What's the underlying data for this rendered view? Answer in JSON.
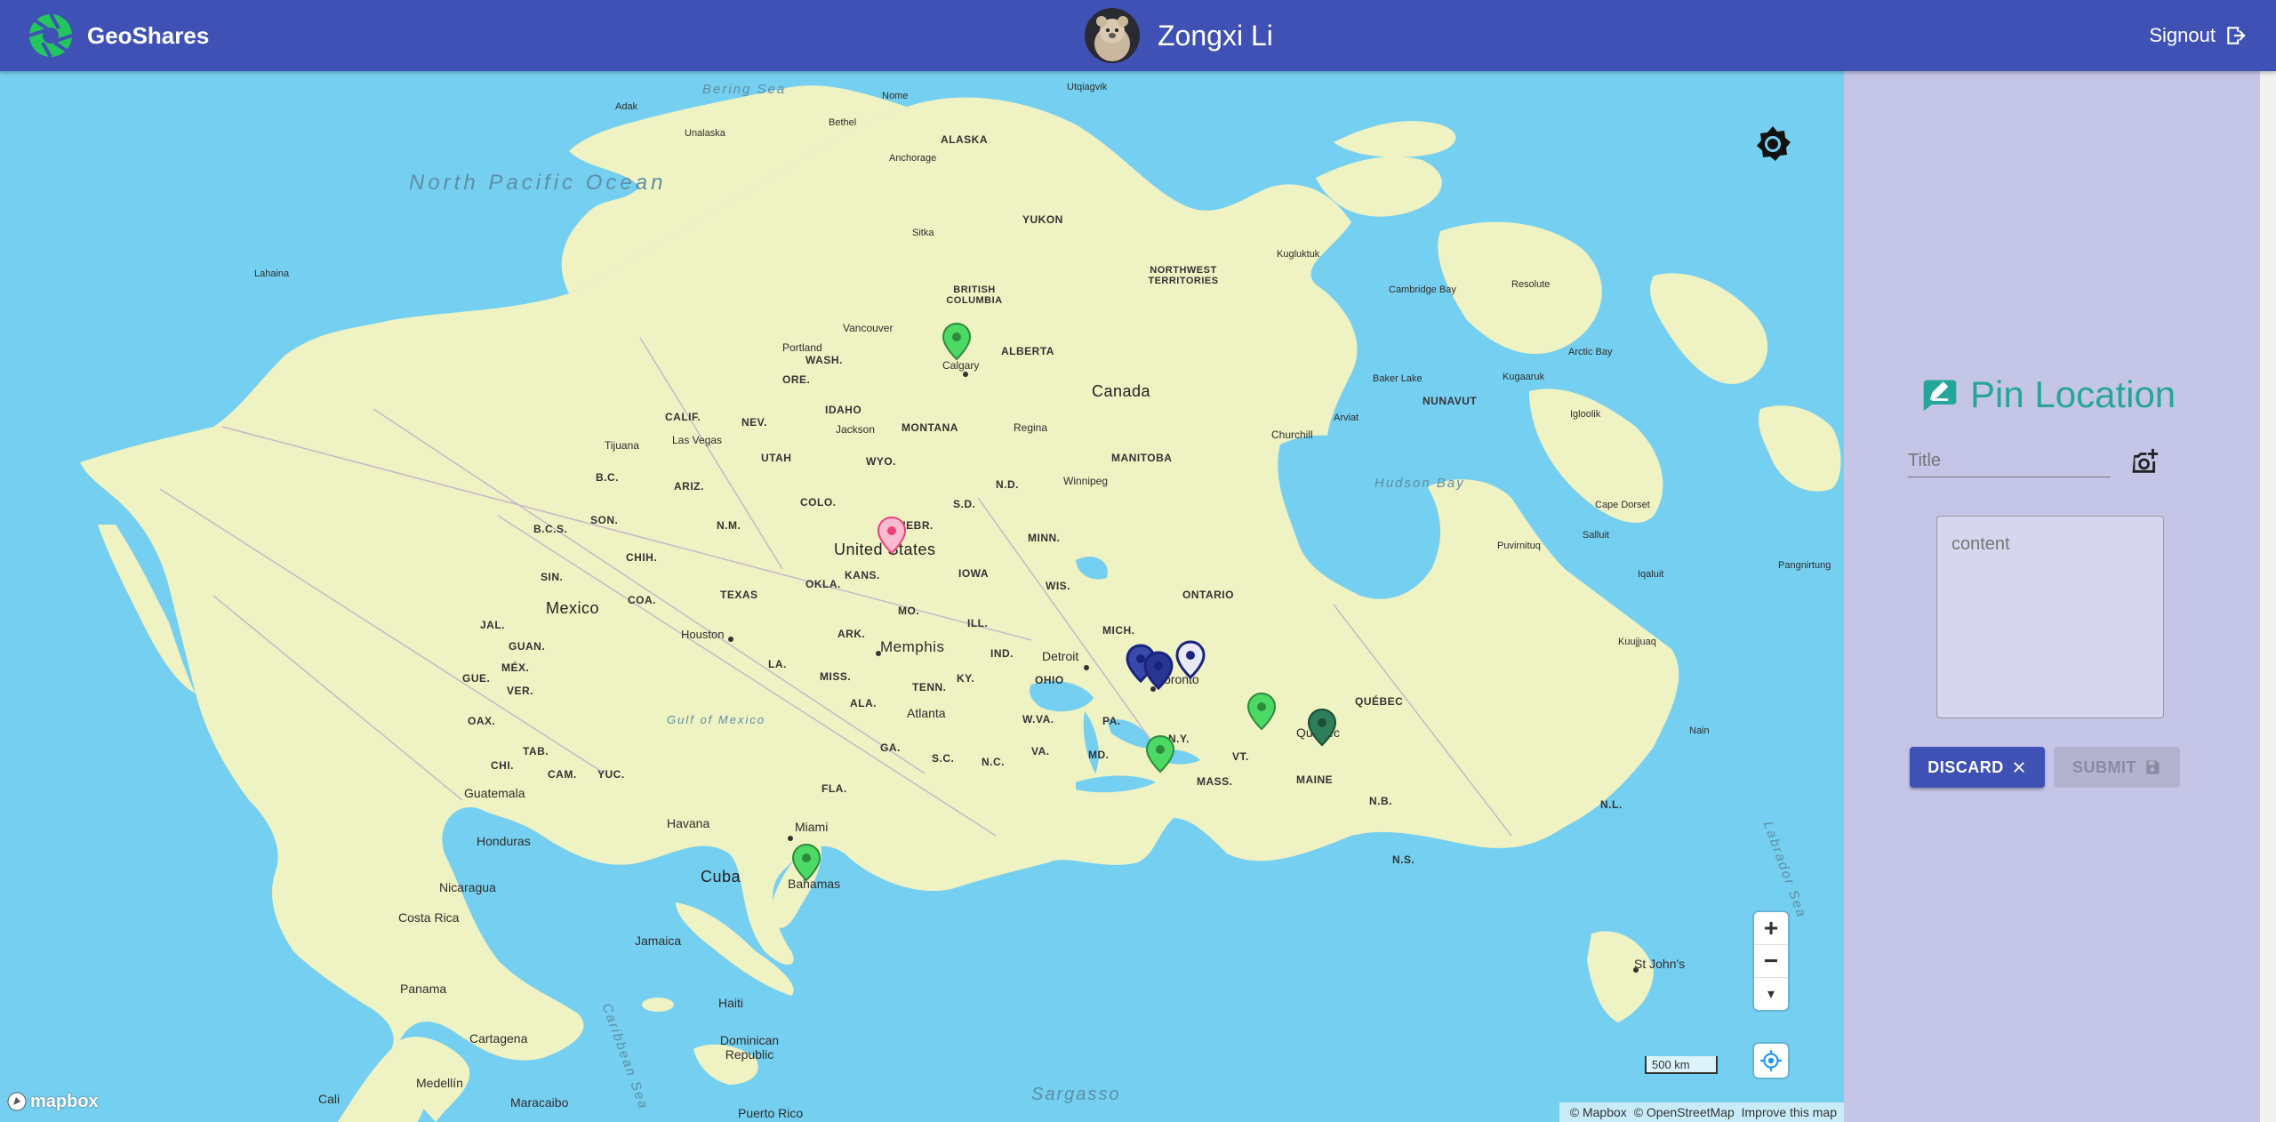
{
  "header": {
    "app_name": "GeoShares",
    "user_name": "Zongxi Li",
    "signout_label": "Signout"
  },
  "map": {
    "water_labels": [
      "North Pacific Ocean",
      "Bering Sea",
      "Hudson Bay",
      "Gulf of Mexico",
      "Caribbean Sea",
      "Labrador Sea",
      "Sargasso"
    ],
    "countries": [
      "Canada",
      "United States",
      "Mexico",
      "Cuba"
    ],
    "region_labels": [
      "ALASKA",
      "YUKON",
      "BRITISH COLUMBIA",
      "NORTHWEST TERRITORIES",
      "ALBERTA",
      "NUNAVUT",
      "MANITOBA",
      "ONTARIO",
      "QUÉBEC",
      "WASH.",
      "ORE.",
      "IDAHO",
      "MONTANA",
      "CALIF.",
      "NEV.",
      "UTAH",
      "WYO.",
      "ARIZ.",
      "COLO.",
      "N.M.",
      "NEBR.",
      "S.D.",
      "N.D.",
      "MINN.",
      "IOWA",
      "WIS.",
      "MICH.",
      "ILL.",
      "IND.",
      "OHIO",
      "KY.",
      "TENN.",
      "MO.",
      "KANS.",
      "OKLA.",
      "TEXAS",
      "ARK.",
      "LA.",
      "MISS.",
      "ALA.",
      "GA.",
      "FLA.",
      "S.C.",
      "N.C.",
      "VA.",
      "W.VA.",
      "PA.",
      "N.Y.",
      "VT.",
      "MAINE",
      "MASS.",
      "MD.",
      "N.B.",
      "N.S.",
      "N.L.",
      "SON.",
      "CHIH.",
      "COA.",
      "B.C.S.",
      "SIN.",
      "JAL.",
      "GUAN.",
      "MÉX.",
      "VER.",
      "OAX.",
      "TAB.",
      "CAM.",
      "YUC.",
      "CHI.",
      "GUE.",
      "B.C."
    ],
    "city_labels": [
      "Nome",
      "Bethel",
      "Anchorage",
      "Utqiagvik",
      "Sitka",
      "Kugluktuk",
      "Cambridge Bay",
      "Resolute",
      "Arctic Bay",
      "Vancouver",
      "Portland",
      "Calgary",
      "Regina",
      "Winnipeg",
      "Churchill",
      "Arviat",
      "Baker Lake",
      "Kugaaruk",
      "Igloolik",
      "Cape Dorset",
      "Salluit",
      "Puvirnituq",
      "Iqaluit",
      "Pangnirtung",
      "Kuujjuaq",
      "Nain",
      "Las Vegas",
      "Tijuana",
      "Jackson",
      "Houston",
      "Memphis",
      "Atlanta",
      "Detroit",
      "Toronto",
      "Québec",
      "Miami",
      "Havana",
      "Bahamas",
      "Jamaica",
      "Haiti",
      "Dominican Republic",
      "Guatemala",
      "Honduras",
      "Nicaragua",
      "Costa Rica",
      "Panama",
      "Cartagena",
      "Medellín",
      "Maracaibo",
      "Cali",
      "Puerto Rico",
      "St John's",
      "Lahaina",
      "Adak",
      "Unalaska"
    ],
    "scale_label": "500 km",
    "zoom_in_label": "+",
    "zoom_out_label": "−",
    "compass_label": "▾",
    "mapbox_logo_text": "mapbox",
    "attribution": {
      "mapbox": "© Mapbox",
      "osm": "© OpenStreetMap",
      "improve": "Improve this map"
    },
    "pin_colors": {
      "green": "#4cd964",
      "blue": "#1a237e",
      "pink": "#f48fb1",
      "teal": "#2e7d5b"
    }
  },
  "panel": {
    "title": "Pin Location",
    "title_placeholder": "Title",
    "content_placeholder": "content",
    "discard_label": "DISCARD",
    "submit_label": "SUBMIT"
  },
  "colors": {
    "primary": "#3f51b5",
    "accent": "#26a69a",
    "panel_bg": "#c5c5e8",
    "water": "#75cff0",
    "land": "#eff2c2"
  }
}
